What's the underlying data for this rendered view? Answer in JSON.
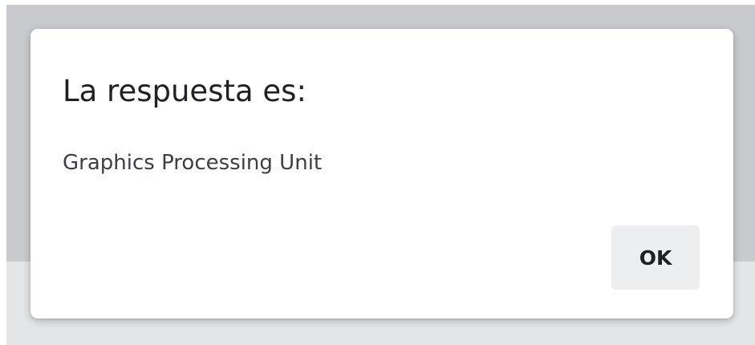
{
  "dialog": {
    "title": "La respuesta es:",
    "message": "Graphics Processing Unit",
    "ok_label": "OK"
  },
  "colors": {
    "backdrop_top": "#c8cacd",
    "backdrop_bottom": "#e4e5e7",
    "dialog_bg": "#ffffff",
    "button_bg": "#eceeef",
    "text": "#202124"
  }
}
